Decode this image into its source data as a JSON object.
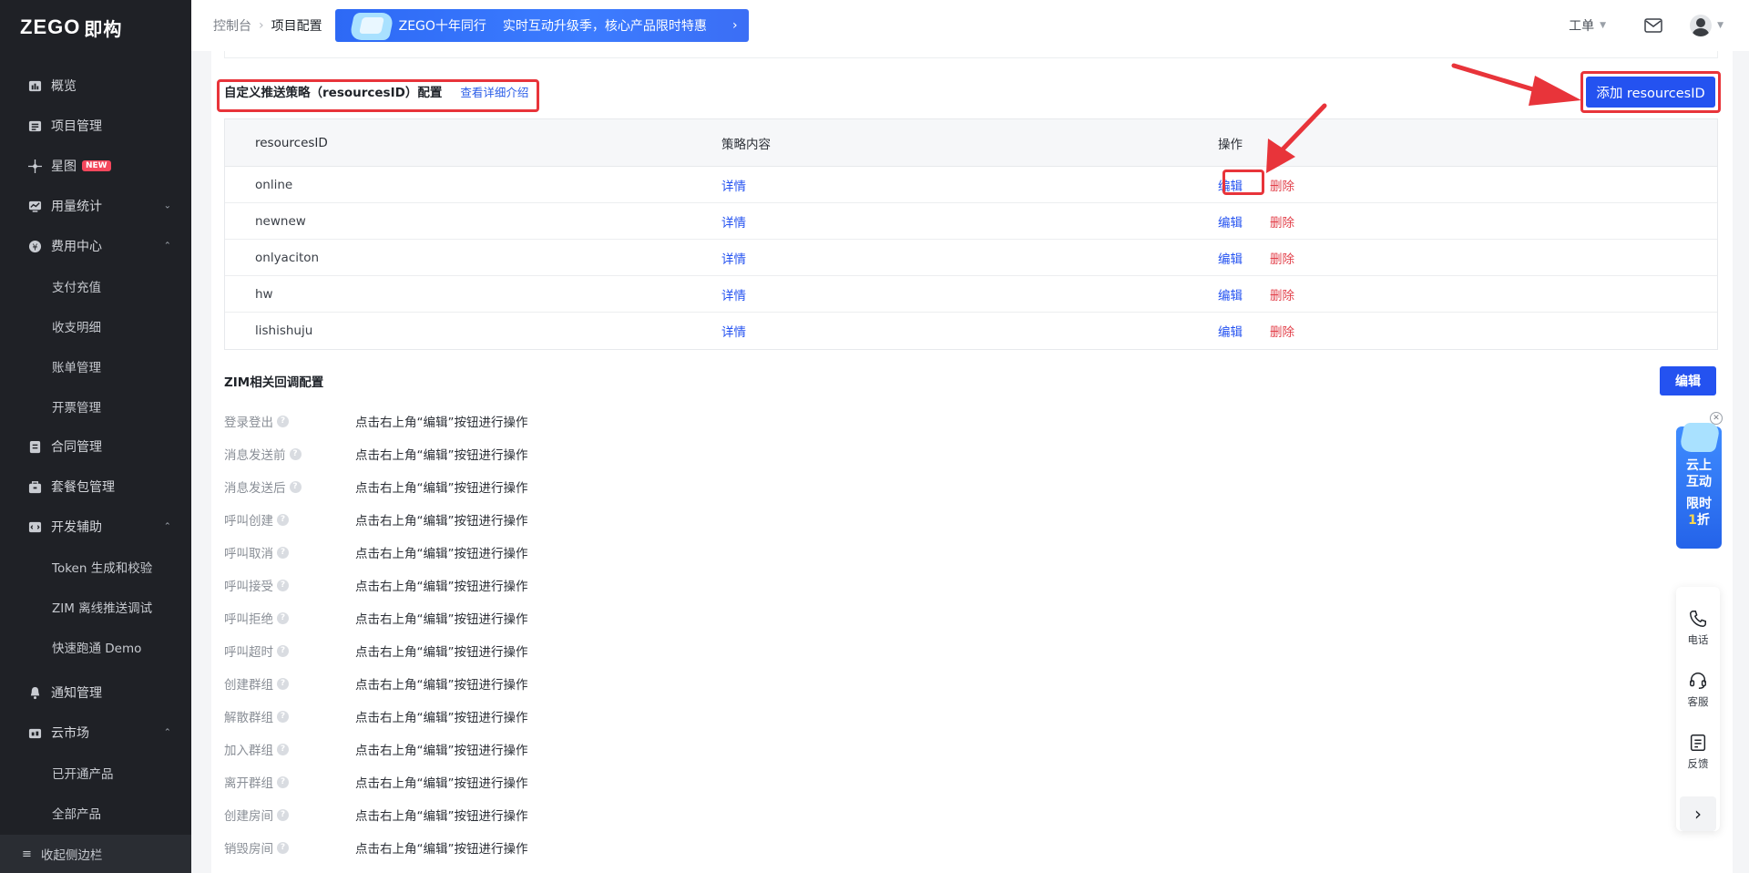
{
  "logo": {
    "en": "ZEGO",
    "cn": "即构"
  },
  "sidebar": {
    "items": [
      {
        "label": "概览",
        "icon": "overview-icon"
      },
      {
        "label": "项目管理",
        "icon": "project-icon"
      },
      {
        "label": "星图",
        "icon": "starmap-icon",
        "badge": "NEW"
      },
      {
        "label": "用量统计",
        "icon": "usage-icon"
      },
      {
        "label": "费用中心",
        "icon": "billing-icon"
      },
      {
        "label": "支付充值"
      },
      {
        "label": "收支明细"
      },
      {
        "label": "账单管理"
      },
      {
        "label": "开票管理"
      },
      {
        "label": "合同管理",
        "icon": "contract-icon"
      },
      {
        "label": "套餐包管理",
        "icon": "package-icon"
      },
      {
        "label": "开发辅助",
        "icon": "dev-icon"
      },
      {
        "label": "Token 生成和校验"
      },
      {
        "label": "ZIM 离线推送调试"
      },
      {
        "label": "快速跑通 Demo"
      },
      {
        "label": "通知管理",
        "icon": "bell-icon"
      },
      {
        "label": "云市场",
        "icon": "market-icon"
      },
      {
        "label": "已开通产品"
      },
      {
        "label": "全部产品"
      }
    ],
    "collapse_label": "收起侧边栏"
  },
  "header": {
    "breadcrumb": [
      "控制台",
      "项目配置"
    ],
    "promo_title": "ZEGO十年同行",
    "promo_text": "实时互动升级季，核心产品限时特惠",
    "ticket_label": "工单"
  },
  "push_section": {
    "title": "自定义推送策略（resourcesID）配置",
    "link": "查看详细介绍",
    "add_button": "添加 resourcesID",
    "columns": [
      "resourcesID",
      "策略内容",
      "操作"
    ],
    "rows": [
      {
        "id": "online",
        "detail": "详情",
        "edit": "编辑",
        "delete": "删除"
      },
      {
        "id": "newnew",
        "detail": "详情",
        "edit": "编辑",
        "delete": "删除"
      },
      {
        "id": "onlyaciton",
        "detail": "详情",
        "edit": "编辑",
        "delete": "删除"
      },
      {
        "id": "hw",
        "detail": "详情",
        "edit": "编辑",
        "delete": "删除"
      },
      {
        "id": "lishishuju",
        "detail": "详情",
        "edit": "编辑",
        "delete": "删除"
      }
    ]
  },
  "zim_section": {
    "title": "ZIM相关回调配置",
    "edit_button": "编辑",
    "hint": "点击右上角“编辑”按钮进行操作",
    "items": [
      "登录登出",
      "消息发送前",
      "消息发送后",
      "呼叫创建",
      "呼叫取消",
      "呼叫接受",
      "呼叫拒绝",
      "呼叫超时",
      "创建群组",
      "解散群组",
      "加入群组",
      "离开群组",
      "创建房间",
      "销毁房间"
    ]
  },
  "float_promo": {
    "line1": "云上",
    "line2": "互动",
    "line3": "限时",
    "num": "1",
    "unit": "折"
  },
  "tools": [
    {
      "label": "电话",
      "icon": "phone-icon"
    },
    {
      "label": "客服",
      "icon": "headset-icon"
    },
    {
      "label": "反馈",
      "icon": "feedback-icon"
    }
  ],
  "colors": {
    "primary": "#2452f0",
    "danger": "#e2414b",
    "highlight": "#e8343a",
    "sidebar_bg": "#1f2126"
  }
}
